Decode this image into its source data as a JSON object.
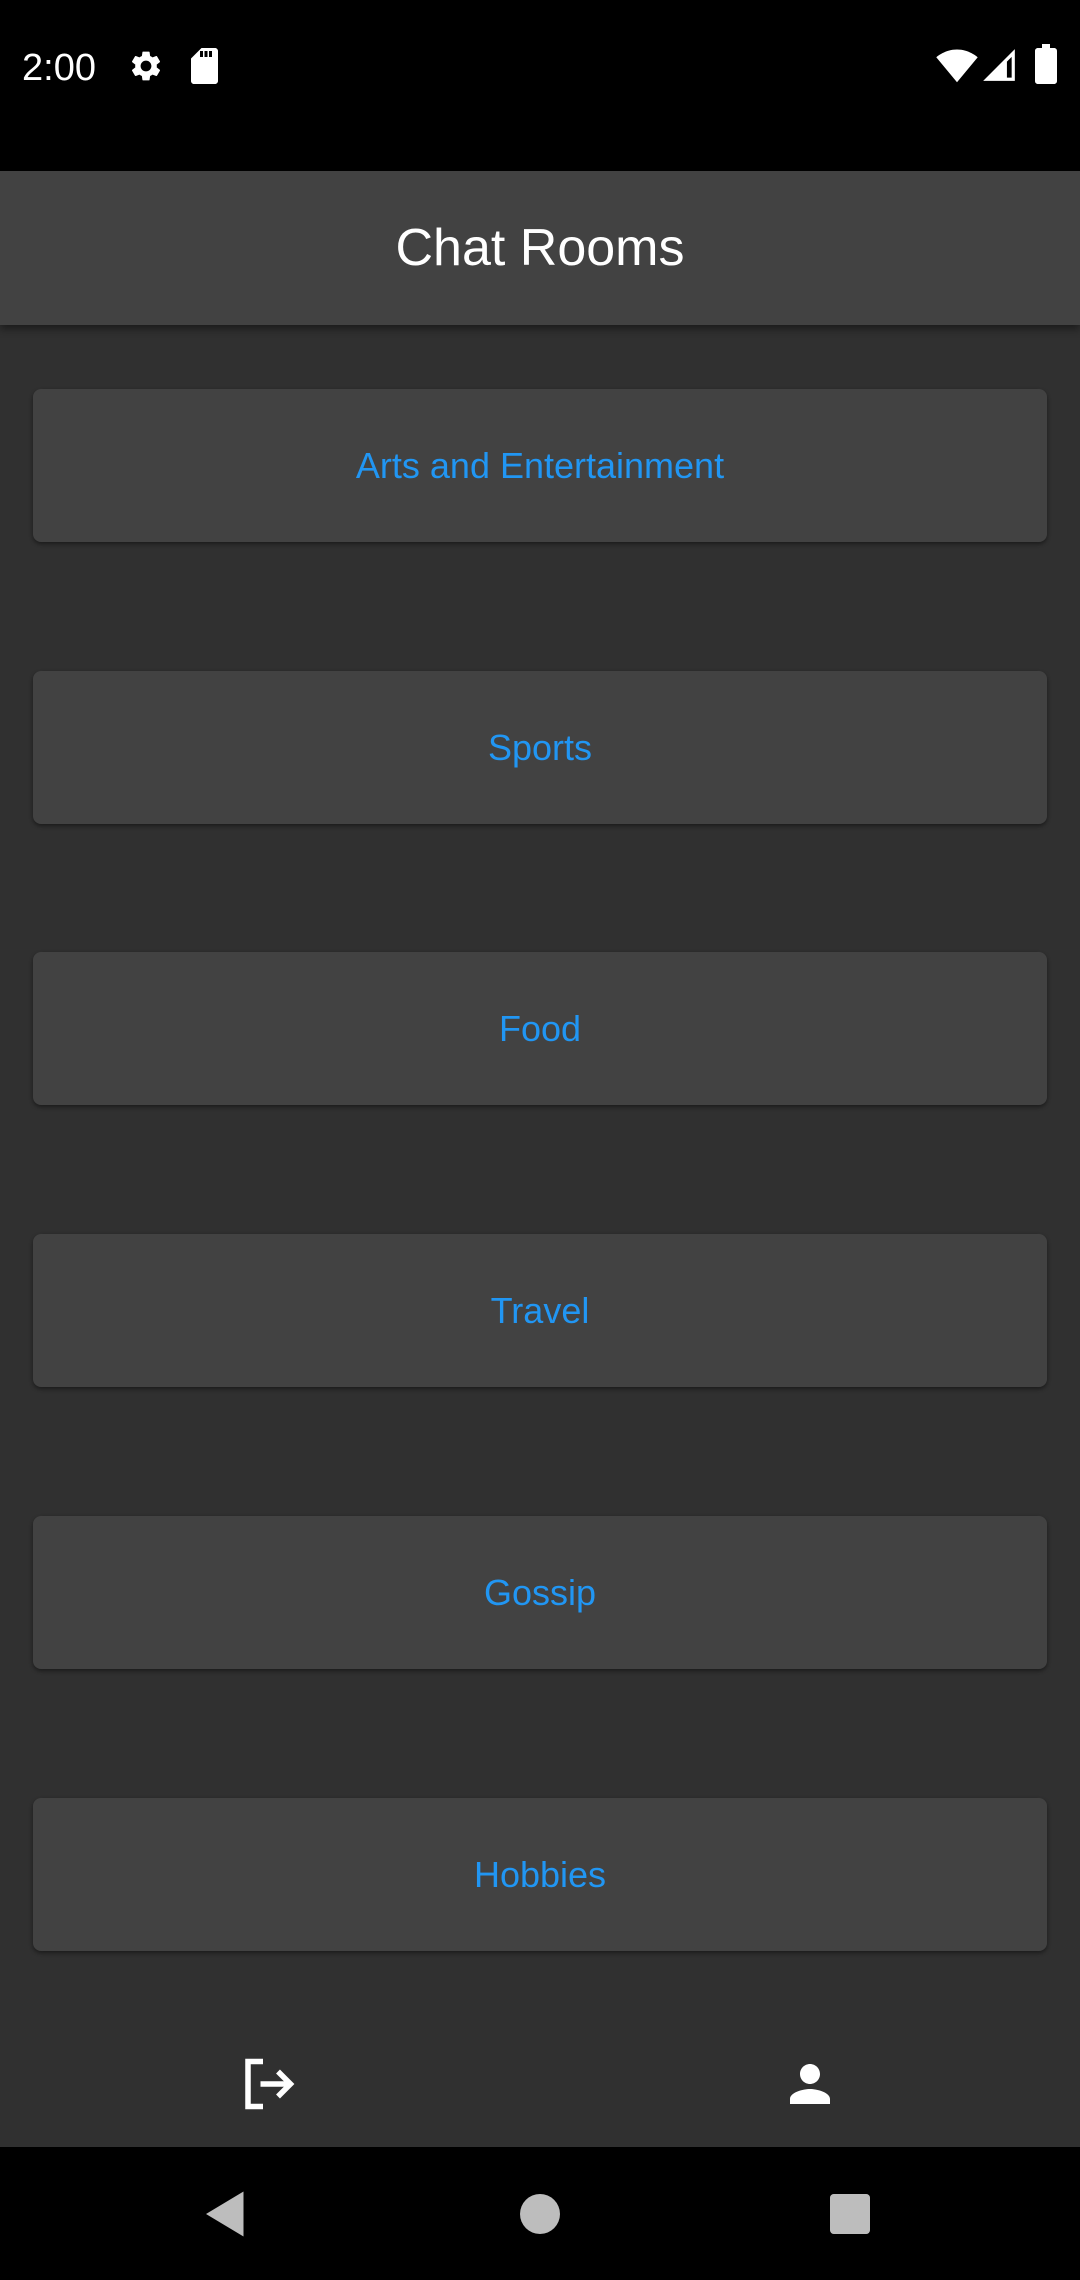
{
  "status_bar": {
    "time": "2:00",
    "icons": [
      "gear-icon",
      "sd-card-icon",
      "wifi-icon",
      "cell-signal-icon",
      "battery-icon"
    ]
  },
  "app_bar": {
    "title": "Chat Rooms"
  },
  "rooms": [
    {
      "label": "Arts and Entertainment"
    },
    {
      "label": "Sports"
    },
    {
      "label": "Food"
    },
    {
      "label": "Travel"
    },
    {
      "label": "Gossip"
    },
    {
      "label": "Hobbies"
    }
  ],
  "bottom_bar": {
    "icons": [
      "logout-icon",
      "profile-icon"
    ]
  },
  "nav_bar": {
    "icons": [
      "back-icon",
      "home-icon",
      "recents-icon"
    ]
  },
  "colors": {
    "background": "#303030",
    "surface": "#424242",
    "accent": "#2196f3",
    "status_bar": "#000000",
    "text": "#ffffff"
  }
}
